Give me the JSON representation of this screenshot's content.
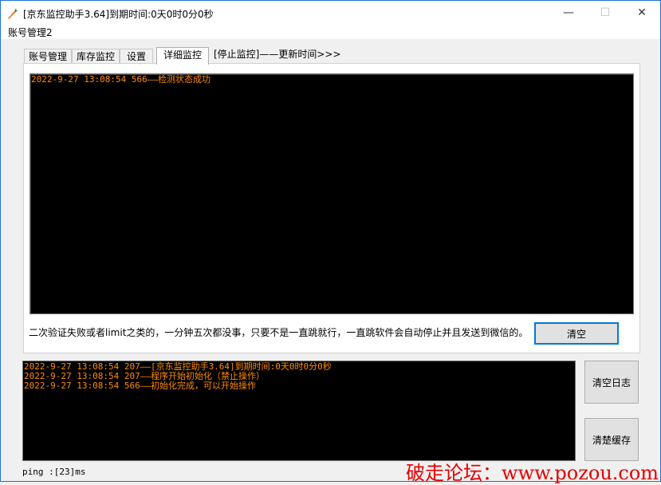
{
  "window": {
    "title": "[京东监控助手3.64]到期时间:0天0时0分0秒",
    "minimize_glyph": "—",
    "maximize_glyph": "☐",
    "close_glyph": "✕"
  },
  "menu": {
    "items": [
      "账号管理2"
    ]
  },
  "tabs": [
    {
      "label": "账号管理",
      "active": false
    },
    {
      "label": "库存监控",
      "active": false
    },
    {
      "label": "设置",
      "active": false
    },
    {
      "label": "详细监控",
      "active": true
    }
  ],
  "status": "[停止监控]——更新时间>>>",
  "detail_log": {
    "lines": [
      "2022-9-27 13:08:54  566——检测状态成功"
    ]
  },
  "hint": "二次验证失败或者limit之类的，一分钟五次都没事，只要不是一直跳就行，一直跳软件会自动停止并且发送到微信的。",
  "clear_button": "清空",
  "main_log": {
    "lines": [
      "2022-9-27 13:08:54  207——[京东监控助手3.64]到期时间:0天0时0分0秒",
      "2022-9-27 13:08:54  207——程序开始初始化（禁止操作）",
      "2022-9-27 13:08:54  566——初始化完成，可以开始操作"
    ]
  },
  "clear_log_button": "清空日志",
  "clear_cache_button": "清楚缓存",
  "ping": "ping :[23]ms",
  "watermark": "破走论坛：www.pozou.com",
  "colors": {
    "log_text": "#ff8c00",
    "log_bg": "#000000",
    "watermark": "#e60000",
    "accent": "#0078d7"
  }
}
